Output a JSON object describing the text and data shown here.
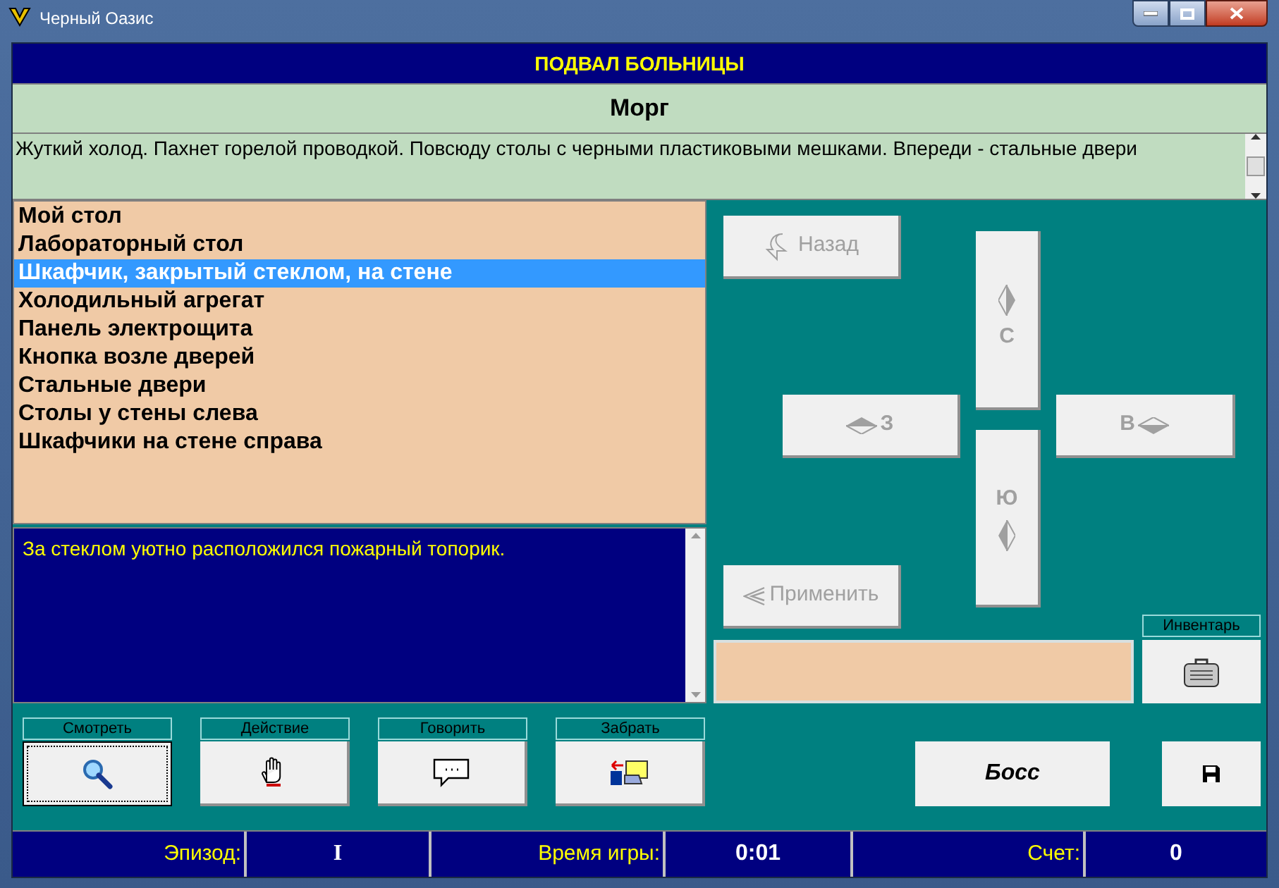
{
  "window": {
    "title": "Черный Оазис"
  },
  "header": "ПОДВАЛ БОЛЬНИЦЫ",
  "location": "Морг",
  "description": "Жуткий холод. Пахнет горелой проводкой. Повсюду столы с черными пластиковыми мешками. Впереди - стальные двери",
  "objects": [
    {
      "label": "Мой стол",
      "selected": false
    },
    {
      "label": "Лабораторный стол",
      "selected": false
    },
    {
      "label": "Шкафчик, закрытый стеклом, на стене",
      "selected": true
    },
    {
      "label": "Холодильный агрегат",
      "selected": false
    },
    {
      "label": "Панель электрощита",
      "selected": false
    },
    {
      "label": "Кнопка возле дверей",
      "selected": false
    },
    {
      "label": "Стальные двери",
      "selected": false
    },
    {
      "label": "Столы у стены слева",
      "selected": false
    },
    {
      "label": "Шкафчики на стене справа",
      "selected": false
    }
  ],
  "message": "За стеклом уютно расположился пожарный топорик.",
  "navigation": [
    {
      "kind": "back",
      "label": "Назад",
      "disabled": true
    },
    {
      "kind": "north",
      "label": "С",
      "disabled": true
    },
    {
      "kind": "west",
      "label": "З",
      "disabled": true
    },
    {
      "kind": "east",
      "label": "В",
      "disabled": true
    },
    {
      "kind": "south",
      "label": "Ю",
      "disabled": true
    },
    {
      "kind": "apply",
      "label": "Применить",
      "disabled": true
    }
  ],
  "inventory": {
    "label": "Инвентарь"
  },
  "actions": [
    {
      "kind": "look",
      "label": "Смотреть",
      "selected": true
    },
    {
      "kind": "act",
      "label": "Действие",
      "selected": false
    },
    {
      "kind": "talk",
      "label": "Говорить",
      "selected": false
    },
    {
      "kind": "take",
      "label": "Забрать",
      "selected": false
    }
  ],
  "boss_button": "Босс",
  "status_bar": [
    {
      "label": "Эпизод:",
      "value": "I"
    },
    {
      "label": "Время игры:",
      "value": "0:01"
    },
    {
      "label": "Счет:",
      "value": "0"
    }
  ]
}
